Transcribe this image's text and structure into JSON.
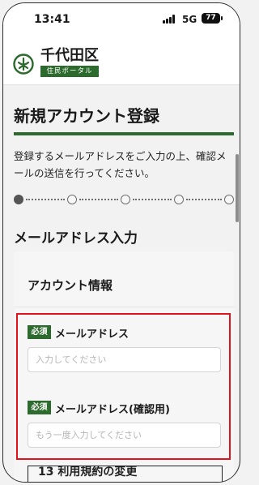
{
  "status": {
    "time": "13:41",
    "network": "5G",
    "battery": "77"
  },
  "header": {
    "city_name": "千代田区",
    "portal_label": "住民ポータル"
  },
  "page": {
    "title": "新規アカウント登録",
    "intro": "登録するメールアドレスをご入力の上、確認メールの送信を行ってください。",
    "steps": {
      "total": 5,
      "current": 1
    },
    "section_title": "メールアドレス入力"
  },
  "form": {
    "card_heading": "アカウント情報",
    "required_badge": "必須",
    "email": {
      "label": "メールアドレス",
      "placeholder": "入力してください",
      "value": ""
    },
    "email_confirm": {
      "label": "メールアドレス(確認用)",
      "placeholder": "もう一度入力してください",
      "value": ""
    },
    "next_section_title": "13 利用規約の変更"
  },
  "colors": {
    "brand_green": "#2d6a2d",
    "highlight_red": "#e0121b"
  }
}
